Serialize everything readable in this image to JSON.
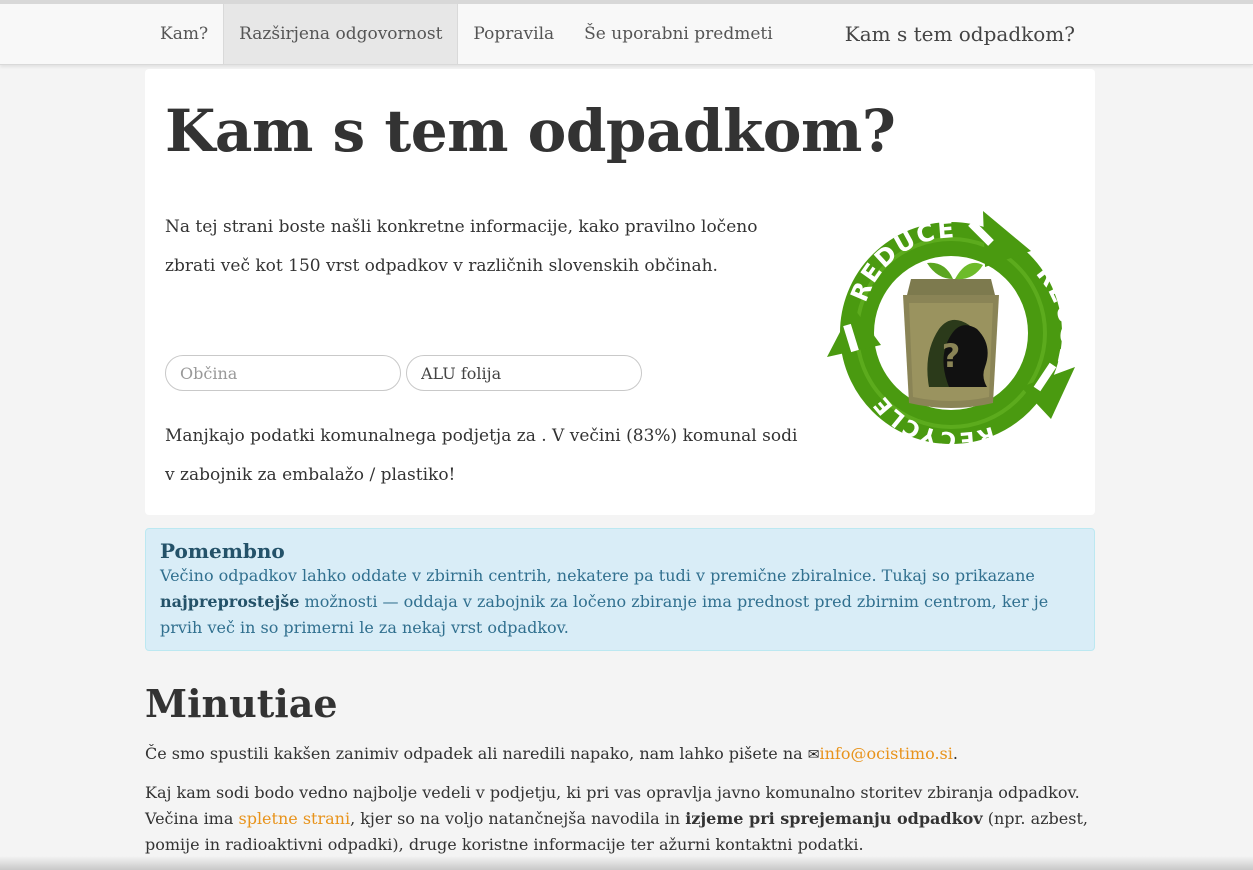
{
  "nav": {
    "items": [
      {
        "label": "Kam?",
        "active": false
      },
      {
        "label": "Razširjena odgovornost",
        "active": true
      },
      {
        "label": "Popravila",
        "active": false
      },
      {
        "label": "Še uporabni predmeti",
        "active": false
      }
    ],
    "brand": "Kam s tem odpadkom?"
  },
  "hero": {
    "title": "Kam s tem odpadkom?",
    "intro": "Na tej strani boste našli konkretne informacije, kako pravilno ločeno zbrati več kot 150 vrst odpadkov v različnih slovenskih občinah.",
    "municipality_placeholder": "Občina",
    "waste_value": "ALU folija",
    "missing_notice": "Manjkajo podatki komunalnega podjetja za . V večini (83%) komunal sodi v zabojnik za embalažo / plastiko!",
    "logo": {
      "words": [
        "REDUCE",
        "REUSE",
        "RECYCLE"
      ],
      "question_mark": "?",
      "icon": "recycle-bin-icon"
    }
  },
  "alert": {
    "title": "Pomembno",
    "text_before": "Večino odpadkov lahko oddate v zbirnih centrih, nekatere pa tudi v premične zbiralnice. Tukaj so prikazane ",
    "text_bold": "najpreprostejše",
    "text_after": " možnosti — oddaja v zabojnik za ločeno zbiranje ima prednost pred zbirnim centrom, ker je prvih več in so primerni le za nekaj vrst odpadkov."
  },
  "minutiae": {
    "title": "Minutiae",
    "p1_before": "Če smo spustili kakšen zanimiv odpadek ali naredili napako, nam lahko pišete na ",
    "mail_icon": "✉",
    "email": "info@ocistimo.si",
    "p1_after": ".",
    "p2_part1": "Kaj kam sodi bodo vedno najbolje vedeli v podjetju, ki pri vas opravlja javno komunalno storitev zbiranja odpadkov. Večina ima ",
    "p2_link": "spletne strani",
    "p2_part2": ", kjer so na voljo natančnejša navodila in ",
    "p2_bold": "izjeme pri sprejemanju odpadkov",
    "p2_part3": " (npr. azbest, pomije in radioaktivni odpadki), druge koristne informacije ter ažurni kontaktni podatki."
  },
  "colors": {
    "link": "#e8931b",
    "alert_bg": "#d9edf7",
    "alert_text": "#31708f",
    "recycle_green": "#4a9a10"
  }
}
